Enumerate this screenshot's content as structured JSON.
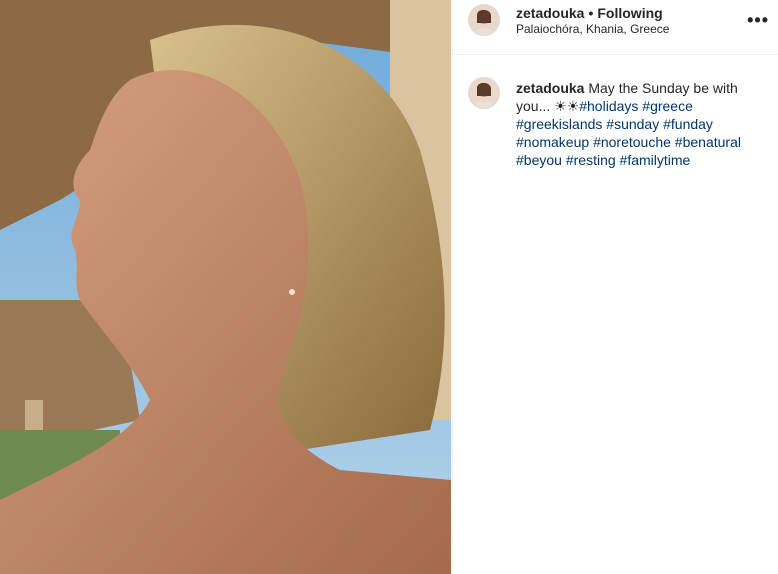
{
  "post": {
    "username": "zetadouka",
    "follow_status": "Following",
    "location": "Palaiochóra, Khania, Greece",
    "caption_text": "May the Sunday be with you... ☀☀",
    "hashtags": [
      "#holidays",
      "#greece",
      "#greekislands",
      "#sunday",
      "#funday",
      "#nomakeup",
      "#noretouche",
      "#benatural",
      "#beyou",
      "#resting",
      "#familytime"
    ]
  },
  "icons": {
    "more": "more-options-icon"
  },
  "colors": {
    "hashtag": "#00376b",
    "text": "#262626",
    "border": "#efefef"
  }
}
